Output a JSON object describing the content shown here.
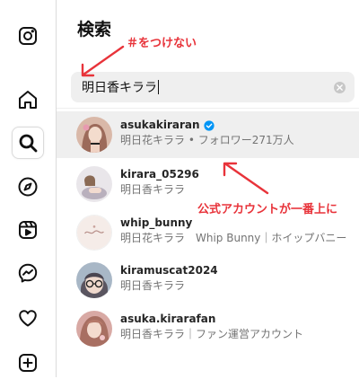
{
  "nav": {
    "items": [
      {
        "icon": "instagram-logo-icon"
      },
      {
        "icon": "home-icon"
      },
      {
        "icon": "search-icon",
        "active": true
      },
      {
        "icon": "explore-compass-icon"
      },
      {
        "icon": "reels-icon"
      },
      {
        "icon": "messenger-icon"
      },
      {
        "icon": "heart-icon"
      },
      {
        "icon": "create-plus-icon"
      }
    ]
  },
  "search": {
    "title": "検索",
    "query": "明日香キララ"
  },
  "results": [
    {
      "username": "asukakiraran",
      "verified": true,
      "subtitle": "明日花キララ • フォロワー271万人",
      "highlight": true
    },
    {
      "username": "kirara_05296",
      "verified": false,
      "subtitle": "明日香キララ"
    },
    {
      "username": "whip_bunny",
      "verified": false,
      "subtitle": "明日花キララ　Whip Bunny｜ホイップバニー"
    },
    {
      "username": "kiramuscat2024",
      "verified": false,
      "subtitle": "明日香キララ"
    },
    {
      "username": "asuka.kirarafan",
      "verified": false,
      "subtitle": "明日香キララ｜ファン運営アカウント"
    }
  ],
  "annotations": {
    "no_hash": "＃をつけない",
    "official_top": "公式アカウントが一番上に"
  },
  "colors": {
    "annotation": "#e8333a",
    "verified": "#0095f6",
    "highlight": "#efefef"
  }
}
